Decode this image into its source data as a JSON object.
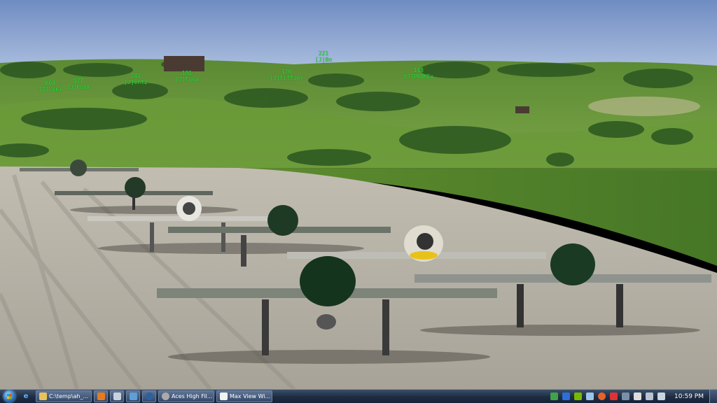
{
  "game": {
    "player_labels": [
      {
        "id": "604",
        "name": "[J]Loki"
      },
      {
        "id": "527",
        "name": "[J]Kodk"
      },
      {
        "id": "242",
        "name": "[J]ent2"
      },
      {
        "id": "191",
        "name": "[J]Fuma"
      },
      {
        "id": "176",
        "name": "[J]tiffier"
      },
      {
        "id": "221",
        "name": "[J]Bn"
      },
      {
        "id": "148",
        "name": "[J]PROKEx"
      }
    ]
  },
  "taskbar": {
    "items": [
      {
        "label": "C:\\temp\\ah_...",
        "icon": "folder-icon"
      },
      {
        "label": "Aces High Fil...",
        "icon": "aces-high-icon"
      },
      {
        "label": "Max View Wi...",
        "icon": "document-icon"
      }
    ],
    "clock": "10:59 PM"
  },
  "colors": {
    "sky": "#8fa8d0",
    "hud_label": "#2fe02f",
    "grass": "#6d9a3a",
    "runway": "#b5b0a4"
  }
}
